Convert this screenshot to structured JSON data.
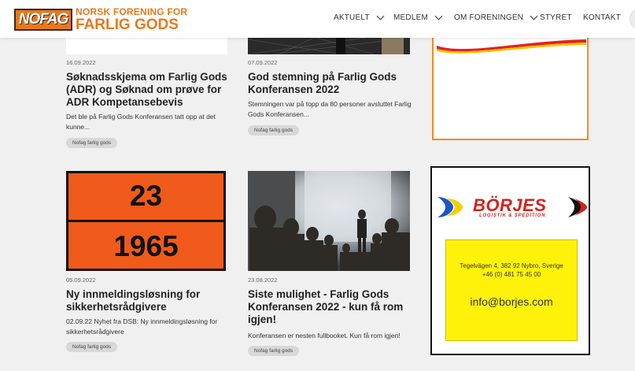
{
  "header": {
    "logo_box": "NOFAG",
    "logo_line1": "NORSK FORENING FOR",
    "logo_line2": "FARLIG GODS",
    "nav": [
      {
        "label": "AKTUELT"
      },
      {
        "label": "MEDLEM"
      },
      {
        "label": "OM FORENINGEN"
      },
      {
        "label": "STYRET"
      },
      {
        "label": "KONTAKT"
      }
    ]
  },
  "posts": [
    {
      "date": "16.09.2022",
      "title": "Søknadsskjema om Farlig Gods (ADR) og Søknad om prøve for ADR Kompetansebevis",
      "excerpt": "Det ble på Farlig Gods Konferansen tatt opp at det kunne...",
      "tag": "Nofag farlig gods"
    },
    {
      "date": "07.09.2022",
      "title": "God stemning på Farlig Gods Konferansen 2022",
      "excerpt": "Stemningen var på topp da 80 personer avsluttet Farlig Gods Konferansen...",
      "tag": "Nofag farlig gods"
    },
    {
      "date": "05.09.2022",
      "title": "Ny innmeldingsløsning for sikkerhetsrådgivere",
      "excerpt": "02.09.22 Nyhet fra DSB: Ny innmeldingsløsning for sikkerhetsrådgivere",
      "tag": "Nofag farlig gods",
      "image": {
        "top_number": "23",
        "bottom_number": "1965"
      }
    },
    {
      "date": "23.08.2022",
      "title": "Siste mulighet - Farlig Gods Konferansen 2022 - kun få rom igjen!",
      "excerpt": "Konferansen er nesten fullbooket. Kun få rom igjen!",
      "tag": "Nofag farlig gods"
    }
  ],
  "ads": {
    "borjes": {
      "name": "BÖRJES",
      "subtitle": "LOGISTIK & SPEDITION",
      "address": "Tegelvägen 4, 382 92 Nybro, Sverige",
      "phone": "+46 (0) 481 75 45 00",
      "email": "info@borjes.com"
    }
  },
  "colors": {
    "brand_orange": "#e8791c",
    "hazard_orange": "#f05a1a",
    "borjes_red": "#d8201c",
    "borjes_yellow": "#fff20a",
    "tag_bg": "#d8d8d8"
  }
}
